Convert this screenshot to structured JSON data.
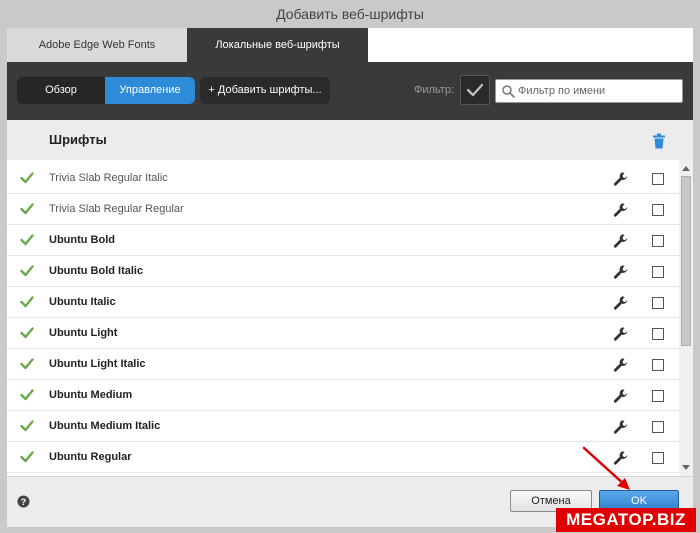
{
  "window": {
    "title": "Добавить веб-шрифты"
  },
  "tabs": [
    {
      "label": "Adobe Edge Web Fonts"
    },
    {
      "label": "Локальные веб-шрифты"
    }
  ],
  "toolbar": {
    "overview_label": "Обзор",
    "manage_label": "Управление",
    "add_fonts_label": "+ Добавить шрифты...",
    "filter_label": "Фильтр:",
    "search_placeholder": "Фильтр по имени"
  },
  "list_header": {
    "title": "Шрифты"
  },
  "fonts": [
    {
      "name": "Trivia Slab Regular Italic",
      "weight": "thin",
      "installed": true,
      "selected": false
    },
    {
      "name": "Trivia Slab Regular Regular",
      "weight": "thin",
      "installed": true,
      "selected": false
    },
    {
      "name": "Ubuntu Bold",
      "weight": "bold",
      "installed": true,
      "selected": false
    },
    {
      "name": "Ubuntu Bold Italic",
      "weight": "bold",
      "installed": true,
      "selected": false
    },
    {
      "name": "Ubuntu Italic",
      "weight": "bold",
      "installed": true,
      "selected": false
    },
    {
      "name": "Ubuntu Light",
      "weight": "bold",
      "installed": true,
      "selected": false
    },
    {
      "name": "Ubuntu Light Italic",
      "weight": "bold",
      "installed": true,
      "selected": false
    },
    {
      "name": "Ubuntu Medium",
      "weight": "bold",
      "installed": true,
      "selected": false
    },
    {
      "name": "Ubuntu Medium Italic",
      "weight": "bold",
      "installed": true,
      "selected": false
    },
    {
      "name": "Ubuntu Regular",
      "weight": "bold",
      "installed": true,
      "selected": false
    }
  ],
  "footer": {
    "cancel_label": "Отмена",
    "ok_label": "OK"
  },
  "watermark": {
    "text": "MEGATOP.BIZ"
  },
  "colors": {
    "accent": "#2e8bd8",
    "check_green": "#6aa84f",
    "toolbar_bg": "#3a3a3a",
    "annotation_arrow": "#e00000"
  }
}
